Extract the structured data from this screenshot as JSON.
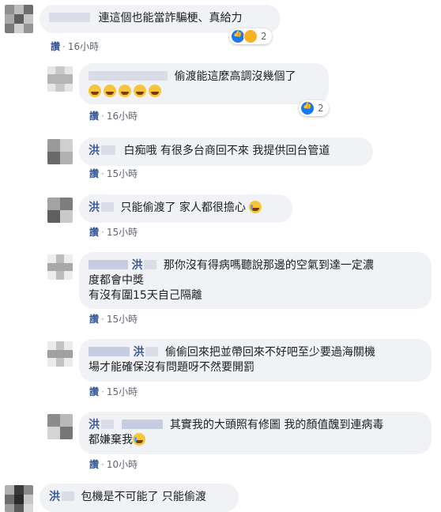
{
  "comments": [
    {
      "id": "c1",
      "text": "連這個也能當詐騙梗、真給力",
      "like_label": "讚",
      "time": "16小時",
      "reactions": {
        "types": [
          "like",
          "haha"
        ],
        "count": "2"
      }
    },
    {
      "id": "c2",
      "text": "偷渡能這麼高調沒幾個了",
      "emojis": [
        "haha-emoji",
        "haha-emoji",
        "haha-emoji",
        "haha-emoji",
        "haha-emoji"
      ],
      "like_label": "讚",
      "time": "16小時",
      "reactions": {
        "types": [
          "like"
        ],
        "count": "2"
      }
    },
    {
      "id": "c3",
      "name": "洪",
      "text": "白痴哦 有很多台商回不來 我提供回台管道",
      "like_label": "讚",
      "time": "15小時"
    },
    {
      "id": "c4",
      "name": "洪",
      "text": "只能偷渡了 家人都很擔心",
      "emojis": [
        "crying-emoji"
      ],
      "like_label": "讚",
      "time": "15小時"
    },
    {
      "id": "c5",
      "name": "洪",
      "text_line1": "那你沒有得病嗎聽說那邊的空氣到達一定濃",
      "text_line2": "度都會中獎",
      "text_line3": "有沒有圍15天自己隔離",
      "like_label": "讚",
      "time": "15小時"
    },
    {
      "id": "c6",
      "name": "洪",
      "text_line1": "偷偷回來把並帶回來不好吧至少要過海關機",
      "text_line2": "場才能確保沒有問題呀不然要開罰",
      "like_label": "讚",
      "time": "15小時"
    },
    {
      "id": "c7",
      "name": "洪",
      "text_line1": "其實我的大頭照有修圖 我的顏值醜到連病毒",
      "text_line2": "都嫌棄我",
      "emojis": [
        "crying-emoji"
      ],
      "like_label": "讚",
      "time": "10小時"
    },
    {
      "id": "c8",
      "name": "洪",
      "text": "包機是不可能了 只能偷渡"
    }
  ]
}
